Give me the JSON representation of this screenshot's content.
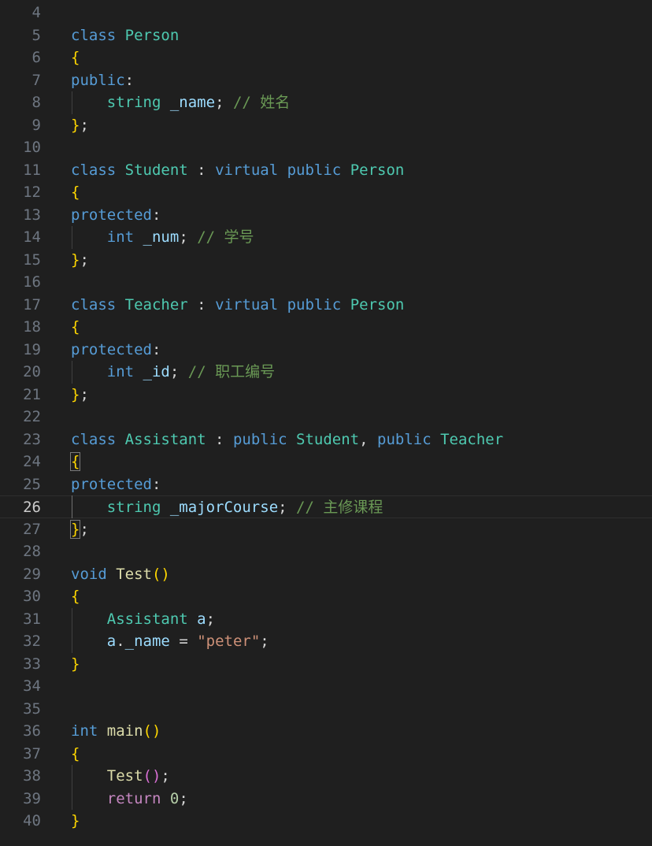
{
  "editor": {
    "current_line": "26",
    "lines": [
      {
        "n": "4",
        "tokens": []
      },
      {
        "n": "5",
        "tokens": [
          [
            "kw",
            "class"
          ],
          [
            "plain",
            " "
          ],
          [
            "type",
            "Person"
          ]
        ]
      },
      {
        "n": "6",
        "tokens": [
          [
            "br",
            "{"
          ]
        ]
      },
      {
        "n": "7",
        "tokens": [
          [
            "kw",
            "public"
          ],
          [
            "plain",
            ":"
          ]
        ]
      },
      {
        "n": "8",
        "tokens": [
          [
            "plain",
            "    "
          ],
          [
            "type",
            "string"
          ],
          [
            "plain",
            " "
          ],
          [
            "var",
            "_name"
          ],
          [
            "plain",
            "; "
          ],
          [
            "cmt",
            "// 姓名"
          ]
        ]
      },
      {
        "n": "9",
        "tokens": [
          [
            "br",
            "}"
          ],
          [
            "plain",
            ";"
          ]
        ]
      },
      {
        "n": "10",
        "tokens": []
      },
      {
        "n": "11",
        "tokens": [
          [
            "kw",
            "class"
          ],
          [
            "plain",
            " "
          ],
          [
            "type",
            "Student"
          ],
          [
            "plain",
            " : "
          ],
          [
            "kw",
            "virtual"
          ],
          [
            "plain",
            " "
          ],
          [
            "kw",
            "public"
          ],
          [
            "plain",
            " "
          ],
          [
            "type",
            "Person"
          ]
        ]
      },
      {
        "n": "12",
        "tokens": [
          [
            "br",
            "{"
          ]
        ]
      },
      {
        "n": "13",
        "tokens": [
          [
            "kw",
            "protected"
          ],
          [
            "plain",
            ":"
          ]
        ]
      },
      {
        "n": "14",
        "tokens": [
          [
            "plain",
            "    "
          ],
          [
            "kw",
            "int"
          ],
          [
            "plain",
            " "
          ],
          [
            "var",
            "_num"
          ],
          [
            "plain",
            "; "
          ],
          [
            "cmt",
            "// 学号"
          ]
        ]
      },
      {
        "n": "15",
        "tokens": [
          [
            "br",
            "}"
          ],
          [
            "plain",
            ";"
          ]
        ]
      },
      {
        "n": "16",
        "tokens": []
      },
      {
        "n": "17",
        "tokens": [
          [
            "kw",
            "class"
          ],
          [
            "plain",
            " "
          ],
          [
            "type",
            "Teacher"
          ],
          [
            "plain",
            " : "
          ],
          [
            "kw",
            "virtual"
          ],
          [
            "plain",
            " "
          ],
          [
            "kw",
            "public"
          ],
          [
            "plain",
            " "
          ],
          [
            "type",
            "Person"
          ]
        ]
      },
      {
        "n": "18",
        "tokens": [
          [
            "br",
            "{"
          ]
        ]
      },
      {
        "n": "19",
        "tokens": [
          [
            "kw",
            "protected"
          ],
          [
            "plain",
            ":"
          ]
        ]
      },
      {
        "n": "20",
        "tokens": [
          [
            "plain",
            "    "
          ],
          [
            "kw",
            "int"
          ],
          [
            "plain",
            " "
          ],
          [
            "var",
            "_id"
          ],
          [
            "plain",
            "; "
          ],
          [
            "cmt",
            "// 职工编号"
          ]
        ]
      },
      {
        "n": "21",
        "tokens": [
          [
            "br",
            "}"
          ],
          [
            "plain",
            ";"
          ]
        ]
      },
      {
        "n": "22",
        "tokens": []
      },
      {
        "n": "23",
        "tokens": [
          [
            "kw",
            "class"
          ],
          [
            "plain",
            " "
          ],
          [
            "type",
            "Assistant"
          ],
          [
            "plain",
            " : "
          ],
          [
            "kw",
            "public"
          ],
          [
            "plain",
            " "
          ],
          [
            "type",
            "Student"
          ],
          [
            "plain",
            ", "
          ],
          [
            "kw",
            "public"
          ],
          [
            "plain",
            " "
          ],
          [
            "type",
            "Teacher"
          ]
        ]
      },
      {
        "n": "24",
        "tokens": [
          [
            "brbox",
            "{"
          ]
        ]
      },
      {
        "n": "25",
        "tokens": [
          [
            "kw",
            "protected"
          ],
          [
            "plain",
            ":"
          ]
        ]
      },
      {
        "n": "26",
        "tokens": [
          [
            "plain",
            "    "
          ],
          [
            "type",
            "string"
          ],
          [
            "plain",
            " "
          ],
          [
            "var",
            "_majorCourse"
          ],
          [
            "plain",
            "; "
          ],
          [
            "cmt",
            "// 主修课程"
          ]
        ]
      },
      {
        "n": "27",
        "tokens": [
          [
            "brbox",
            "}"
          ],
          [
            "plain",
            ";"
          ]
        ]
      },
      {
        "n": "28",
        "tokens": []
      },
      {
        "n": "29",
        "tokens": [
          [
            "kw",
            "void"
          ],
          [
            "plain",
            " "
          ],
          [
            "fn",
            "Test"
          ],
          [
            "br",
            "()"
          ]
        ]
      },
      {
        "n": "30",
        "tokens": [
          [
            "br",
            "{"
          ]
        ]
      },
      {
        "n": "31",
        "tokens": [
          [
            "plain",
            "    "
          ],
          [
            "type",
            "Assistant"
          ],
          [
            "plain",
            " "
          ],
          [
            "var",
            "a"
          ],
          [
            "plain",
            ";"
          ]
        ]
      },
      {
        "n": "32",
        "tokens": [
          [
            "plain",
            "    "
          ],
          [
            "var",
            "a"
          ],
          [
            "plain",
            "."
          ],
          [
            "var",
            "_name"
          ],
          [
            "plain",
            " = "
          ],
          [
            "str",
            "\"peter\""
          ],
          [
            "plain",
            ";"
          ]
        ]
      },
      {
        "n": "33",
        "tokens": [
          [
            "br",
            "}"
          ]
        ]
      },
      {
        "n": "34",
        "tokens": []
      },
      {
        "n": "35",
        "tokens": []
      },
      {
        "n": "36",
        "tokens": [
          [
            "kw",
            "int"
          ],
          [
            "plain",
            " "
          ],
          [
            "fn",
            "main"
          ],
          [
            "br",
            "()"
          ]
        ]
      },
      {
        "n": "37",
        "tokens": [
          [
            "br",
            "{"
          ]
        ]
      },
      {
        "n": "38",
        "tokens": [
          [
            "plain",
            "    "
          ],
          [
            "fn",
            "Test"
          ],
          [
            "br2",
            "()"
          ],
          [
            "plain",
            ";"
          ]
        ]
      },
      {
        "n": "39",
        "tokens": [
          [
            "plain",
            "    "
          ],
          [
            "ctl",
            "return"
          ],
          [
            "plain",
            " "
          ],
          [
            "num",
            "0"
          ],
          [
            "plain",
            ";"
          ]
        ]
      },
      {
        "n": "40",
        "tokens": [
          [
            "br",
            "}"
          ]
        ]
      }
    ]
  },
  "colors": {
    "background": "#1f1f1f",
    "keyword": "#569cd6",
    "type": "#4ec9b0",
    "variable": "#9cdcfe",
    "function": "#dcdcaa",
    "string": "#ce9178",
    "number": "#b5cea8",
    "comment": "#6a9955",
    "control": "#c586c0",
    "bracket": "#ffd700",
    "bracket2": "#da70d6"
  }
}
